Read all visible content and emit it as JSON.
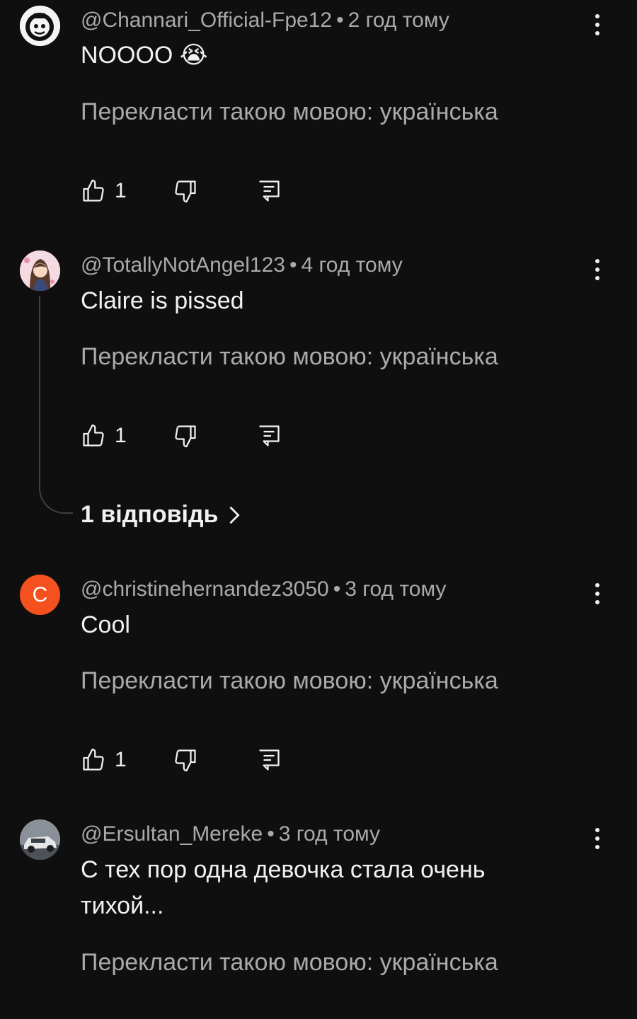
{
  "comments": [
    {
      "handle": "@Channari_Official-Fpe12",
      "time": "2 год тому",
      "text": "NOOOO 😭",
      "translate": "Перекласти такою мовою: українська",
      "likes": "1",
      "avatar_icon": "cartoon-avatar"
    },
    {
      "handle": "@TotallyNotAngel123",
      "time": "4 год тому",
      "text": "Claire is pissed",
      "translate": "Перекласти такою мовою: українська",
      "likes": "1",
      "replies": "1 відповідь",
      "avatar_icon": "anime-girl-avatar"
    },
    {
      "handle": "@christinehernandez3050",
      "time": "3 год тому",
      "text": "Cool",
      "translate": "Перекласти такою мовою: українська",
      "likes": "1",
      "avatar_letter": "C",
      "avatar_color": "#f4511e"
    },
    {
      "handle": "@Ersultan_Mereke",
      "time": "3 год тому",
      "text": "С тех пор одна девочка стала очень тихой...",
      "translate": "Перекласти такою мовою: українська",
      "avatar_icon": "car-photo-avatar"
    }
  ],
  "meta_separator": "•",
  "colors": {
    "background": "#0f0f0f",
    "primary_text": "#f1f1f1",
    "secondary_text": "#aaaaaa",
    "thread_line": "#3f3f3f"
  }
}
